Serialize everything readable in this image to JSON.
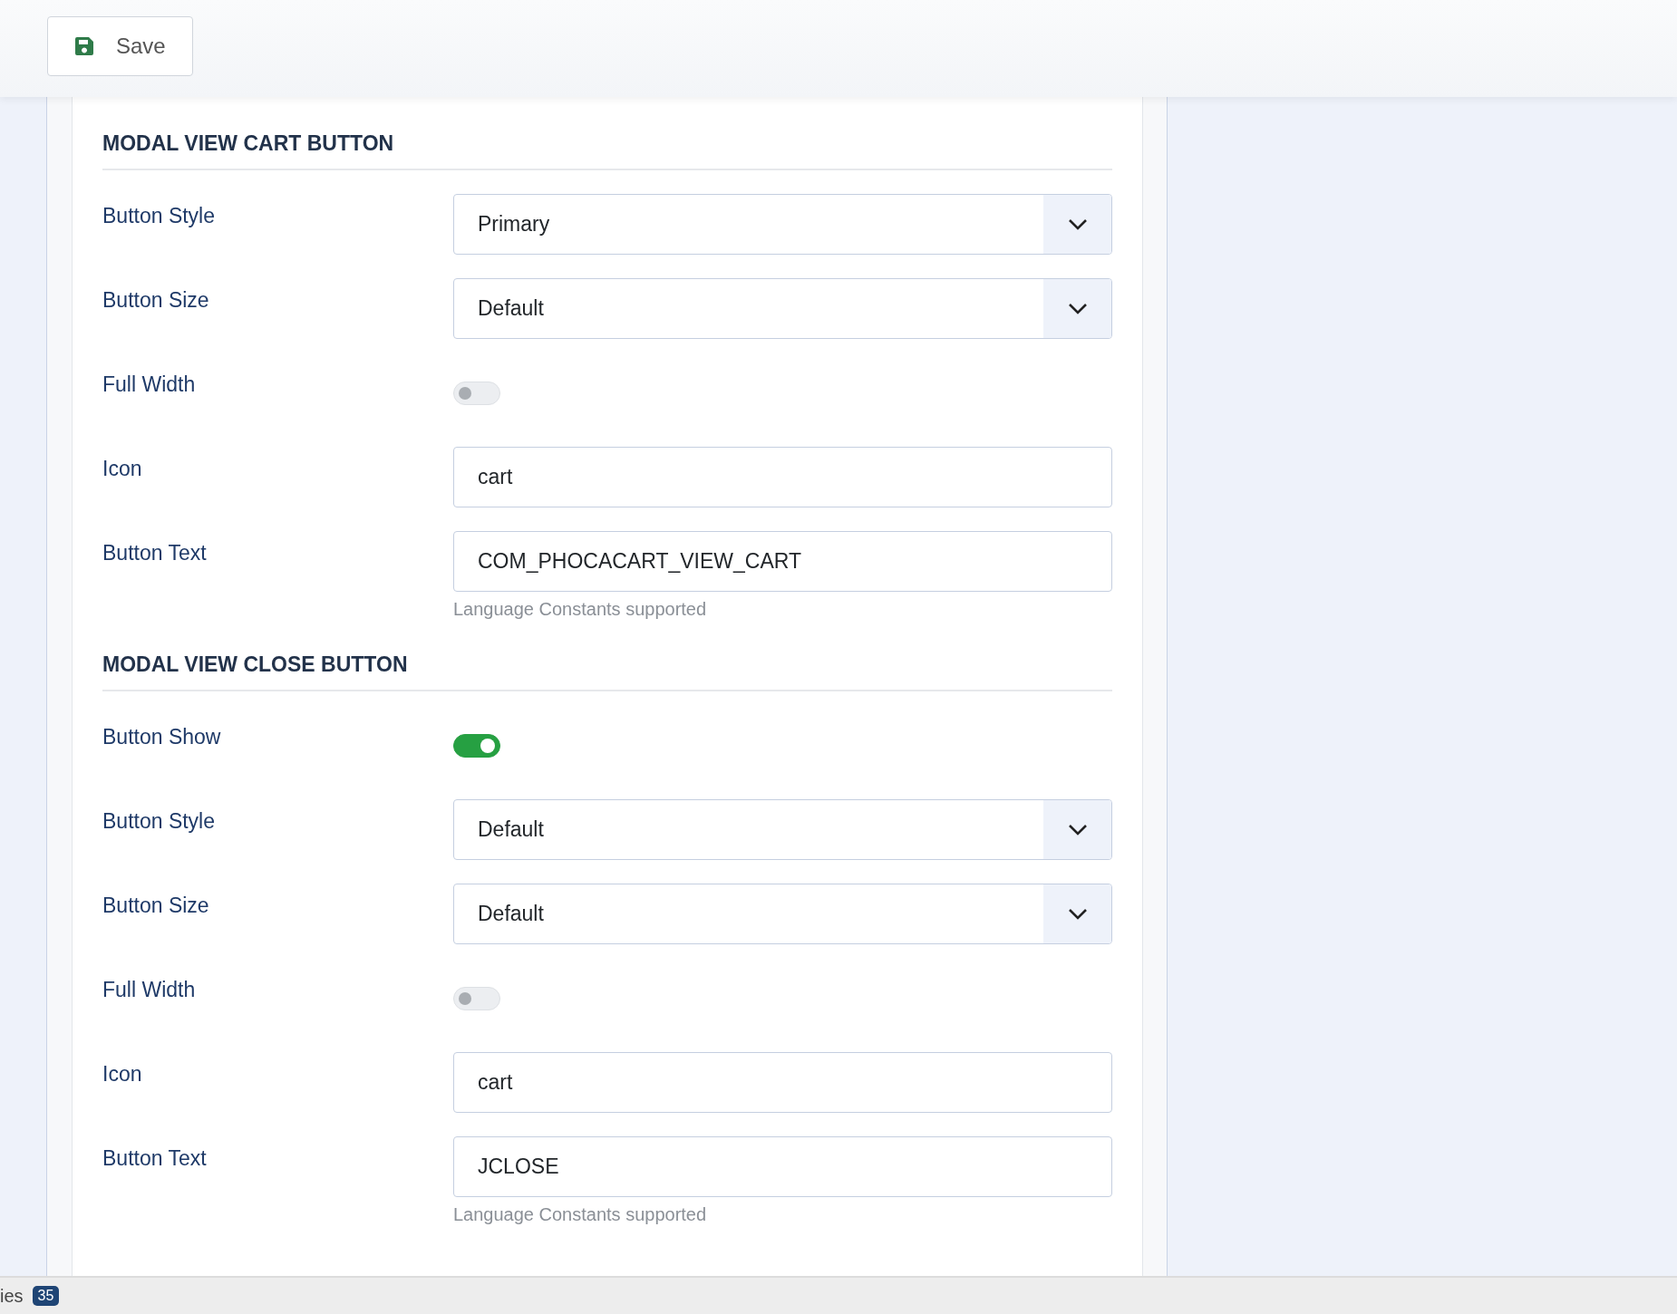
{
  "toolbar": {
    "save_button": "Save"
  },
  "sections": [
    {
      "title": "MODAL VIEW CART BUTTON",
      "fields": [
        {
          "kind": "select",
          "label": "Button Style",
          "value": "Primary"
        },
        {
          "kind": "select",
          "label": "Button Size",
          "value": "Default"
        },
        {
          "kind": "toggle",
          "label": "Full Width",
          "on": false
        },
        {
          "kind": "text",
          "label": "Icon",
          "value": "cart"
        },
        {
          "kind": "text",
          "label": "Button Text",
          "value": "COM_PHOCACART_VIEW_CART",
          "help": "Language Constants supported"
        }
      ]
    },
    {
      "title": "MODAL VIEW CLOSE BUTTON",
      "fields": [
        {
          "kind": "toggle",
          "label": "Button Show",
          "on": true
        },
        {
          "kind": "select",
          "label": "Button Style",
          "value": "Default"
        },
        {
          "kind": "select",
          "label": "Button Size",
          "value": "Default"
        },
        {
          "kind": "toggle",
          "label": "Full Width",
          "on": false
        },
        {
          "kind": "text",
          "label": "Icon",
          "value": "cart"
        },
        {
          "kind": "text",
          "label": "Button Text",
          "value": "JCLOSE",
          "help": "Language Constants supported"
        }
      ]
    }
  ],
  "status_bar": {
    "text": "ies",
    "badge": "35"
  }
}
